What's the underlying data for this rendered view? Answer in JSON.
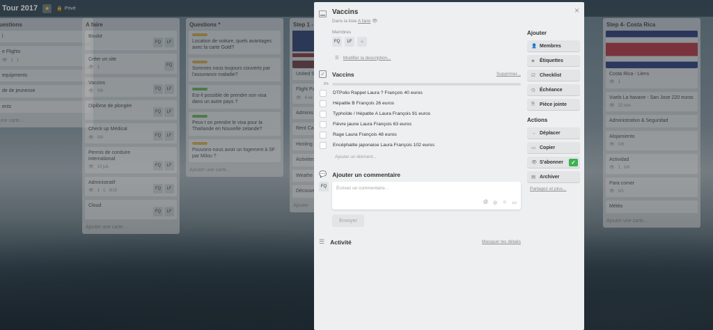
{
  "board": {
    "title": "Tour 2017",
    "visibility": "Privé"
  },
  "lists": [
    {
      "title": "uestions",
      "cards": [
        {
          "text": "l"
        },
        {
          "text": "e Flights",
          "meta": [
            "1",
            "1"
          ]
        },
        {
          "text": "equipments"
        },
        {
          "text": "de de jeunesse"
        },
        {
          "text": "ents"
        }
      ],
      "add": "une carte..."
    },
    {
      "title": "A faire",
      "cards": [
        {
          "text": "Boulot",
          "members": [
            "FQ",
            "LF"
          ]
        },
        {
          "text": "Créer un site",
          "meta": [
            "1"
          ],
          "members": [
            "FQ"
          ]
        },
        {
          "text": "Vaccins",
          "meta": [
            "0/6"
          ],
          "members": [
            "FQ",
            "LF"
          ]
        },
        {
          "text": "Diplôme de plongée",
          "members": [
            "FQ",
            "LF"
          ]
        },
        {
          "text": "Check up Médical",
          "meta": [
            "0/8"
          ],
          "members": [
            "FQ",
            "LF"
          ]
        },
        {
          "text": "Permis de conduire international",
          "meta": [
            "10 juil."
          ],
          "members": [
            "FQ",
            "LF"
          ]
        },
        {
          "text": "Administratif",
          "meta": [
            "1",
            "1",
            "0/15"
          ],
          "members": [
            "FQ",
            "LF"
          ]
        },
        {
          "text": "Cloud",
          "members": [
            "FQ",
            "LF"
          ]
        }
      ],
      "add": "Ajouter une carte..."
    },
    {
      "title": "Questions *",
      "cards": [
        {
          "text": "Location de voiture, quels avantages avec la carte Gold?",
          "label": "#f2b73a"
        },
        {
          "text": "Sommes nous toujours couverts par l'assurance maladie?",
          "label": "#f2b73a"
        },
        {
          "text": "Est-il possible de prendre son visa dans un autre pays ?",
          "label": "#61bd4f"
        },
        {
          "text": "Peux t on prendre le visa pour la Thaïlande en Nouvelle zelande?",
          "label": "#61bd4f"
        },
        {
          "text": "Pouvons-nous avoir un logement à SF par Milou ?",
          "label": "#f2b73a"
        }
      ],
      "add": "Ajouter une carte..."
    },
    {
      "title": "Step 1 -",
      "cards": [
        {
          "text": "United S October",
          "flag": "usa"
        },
        {
          "text": "Flight Pa",
          "meta": [
            "4 se"
          ]
        },
        {
          "text": "Adminis"
        },
        {
          "text": "Rent Ca"
        },
        {
          "text": "Hosting"
        },
        {
          "text": "Activities"
        },
        {
          "text": "Weathe"
        },
        {
          "text": "Découve PRVTn O"
        }
      ],
      "add": "Ajouter"
    },
    {
      "title": "Step 4- Costa Rica",
      "cards": [
        {
          "text": "Costa Rica - Liens",
          "flag": "cr",
          "meta": [
            "1"
          ]
        },
        {
          "text": "Vuelo La havane - San Jose 220 euros",
          "meta": [
            "22 nov."
          ]
        },
        {
          "text": "Administrativo & Seguridad"
        },
        {
          "text": "Alojamiento",
          "meta": [
            "0/8"
          ]
        },
        {
          "text": "Actividad",
          "meta": [
            "1",
            "0/6"
          ]
        },
        {
          "text": "Para comer",
          "meta": [
            "0/1"
          ]
        },
        {
          "text": "Météo"
        }
      ],
      "add": "Ajouter une carte..."
    }
  ],
  "modal": {
    "title": "Vaccins",
    "in_list_prefix": "Dans la liste",
    "in_list_name": "A faire",
    "members_label": "Membres",
    "members": [
      "FQ",
      "LF"
    ],
    "add_member": "+",
    "edit_description": "Modifier la description...",
    "checklist": {
      "title": "Vaccins",
      "delete": "Supprimer...",
      "progress": "0%",
      "progress_value": 0,
      "items": [
        "DTPolio Rappel Laura ? François 40 euros",
        "Hépatite B François 26 euros",
        "Typhoïde / Hépatite A Laura François 91 euros",
        "Fièvre jaune Laura François 63 euros",
        "Rage Laura François 48 euros",
        "Encéphalite japonaise Laura François 102 euros"
      ],
      "add_item": "Ajouter un élément..."
    },
    "comment": {
      "title": "Ajouter un commentaire",
      "avatar": "FQ",
      "placeholder": "Écrivez un commentaire...",
      "send": "Envoyer"
    },
    "activity": {
      "title": "Activité",
      "hide": "Masquer les détails"
    },
    "add_section": {
      "title": "Ajouter",
      "buttons": [
        "Membres",
        "Étiquettes",
        "Checklist",
        "Échéance",
        "Pièce jointe"
      ]
    },
    "actions_section": {
      "title": "Actions",
      "buttons": [
        "Déplacer",
        "Copier",
        "S'abonner",
        "Archiver"
      ]
    },
    "share": "Partagez et plus...",
    "close": "×"
  },
  "colors": {
    "accent_green": "#3cb34f",
    "label_yellow": "#f2b73a",
    "label_green": "#61bd4f"
  }
}
